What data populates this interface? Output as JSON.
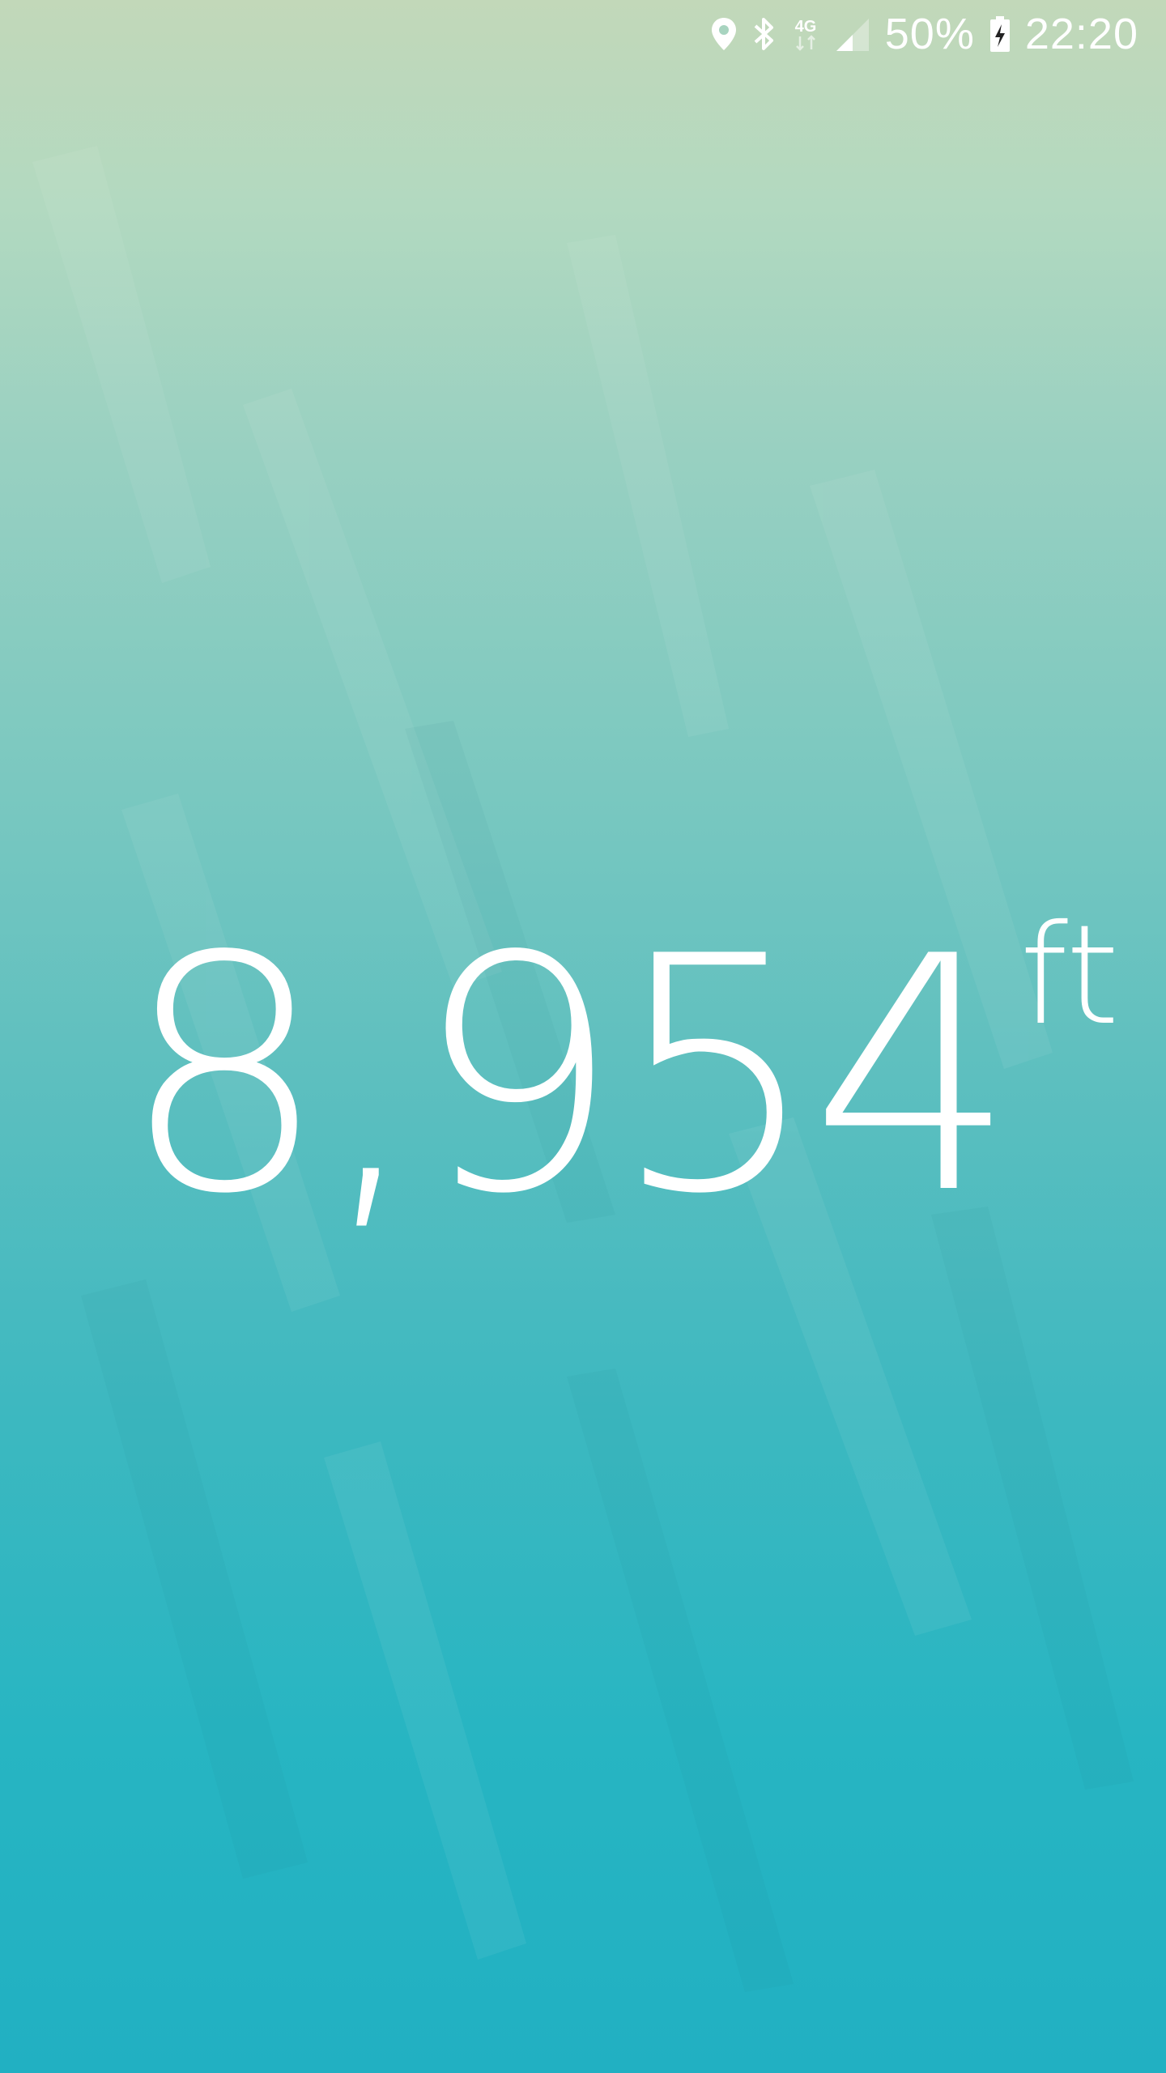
{
  "status_bar": {
    "icons": [
      "location-icon",
      "bluetooth-icon",
      "network-4g-icon",
      "signal-icon",
      "battery-charging-icon"
    ],
    "network_label": "4G",
    "battery_percent": "50%",
    "time": "22:20"
  },
  "altitude": {
    "value": "8,954",
    "unit": "ft"
  },
  "colors": {
    "background_top": "#c2d8b9",
    "background_bottom": "#21b0c2",
    "text": "#ffffff"
  }
}
